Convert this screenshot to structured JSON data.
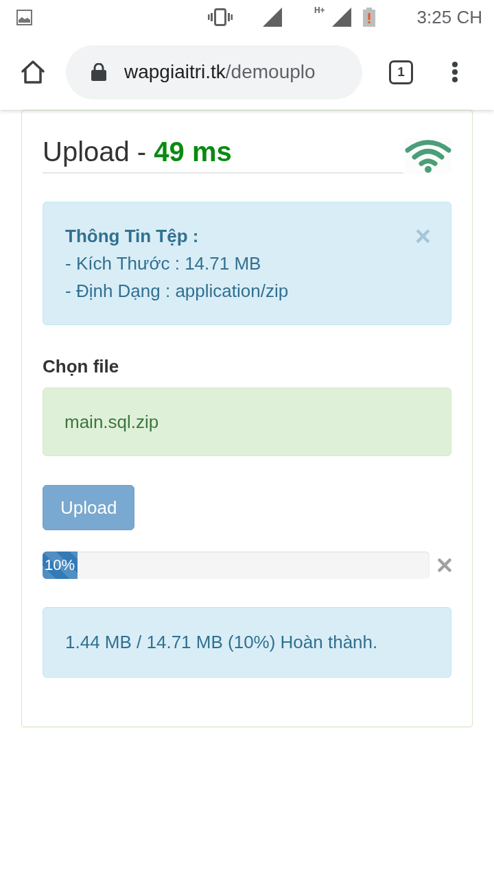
{
  "status_bar": {
    "network_type": "H+",
    "time": "3:25 CH"
  },
  "browser": {
    "secure": true,
    "url": {
      "host": "wapgiaitri.tk",
      "path": "/demouplo"
    },
    "tab_count": "1"
  },
  "panel": {
    "title": "Upload - **49 ms**",
    "file_info": {
      "heading": "Thông Tin Tệp :",
      "lines": [
        "- Kích Thước : 14.71 MB",
        "- Định Dạng : application/zip"
      ],
      "close": "×"
    },
    "file_label": "Chọn file",
    "file_field": {
      "value": "main.sql.zip"
    },
    "upload_button": {
      "label": "Upload",
      "disabled": true
    },
    "progress": {
      "level": 0.09,
      "label": "10%"
    },
    "status": "1.44 MB / 14.71 MB (10%) Hoàn thành."
  }
}
